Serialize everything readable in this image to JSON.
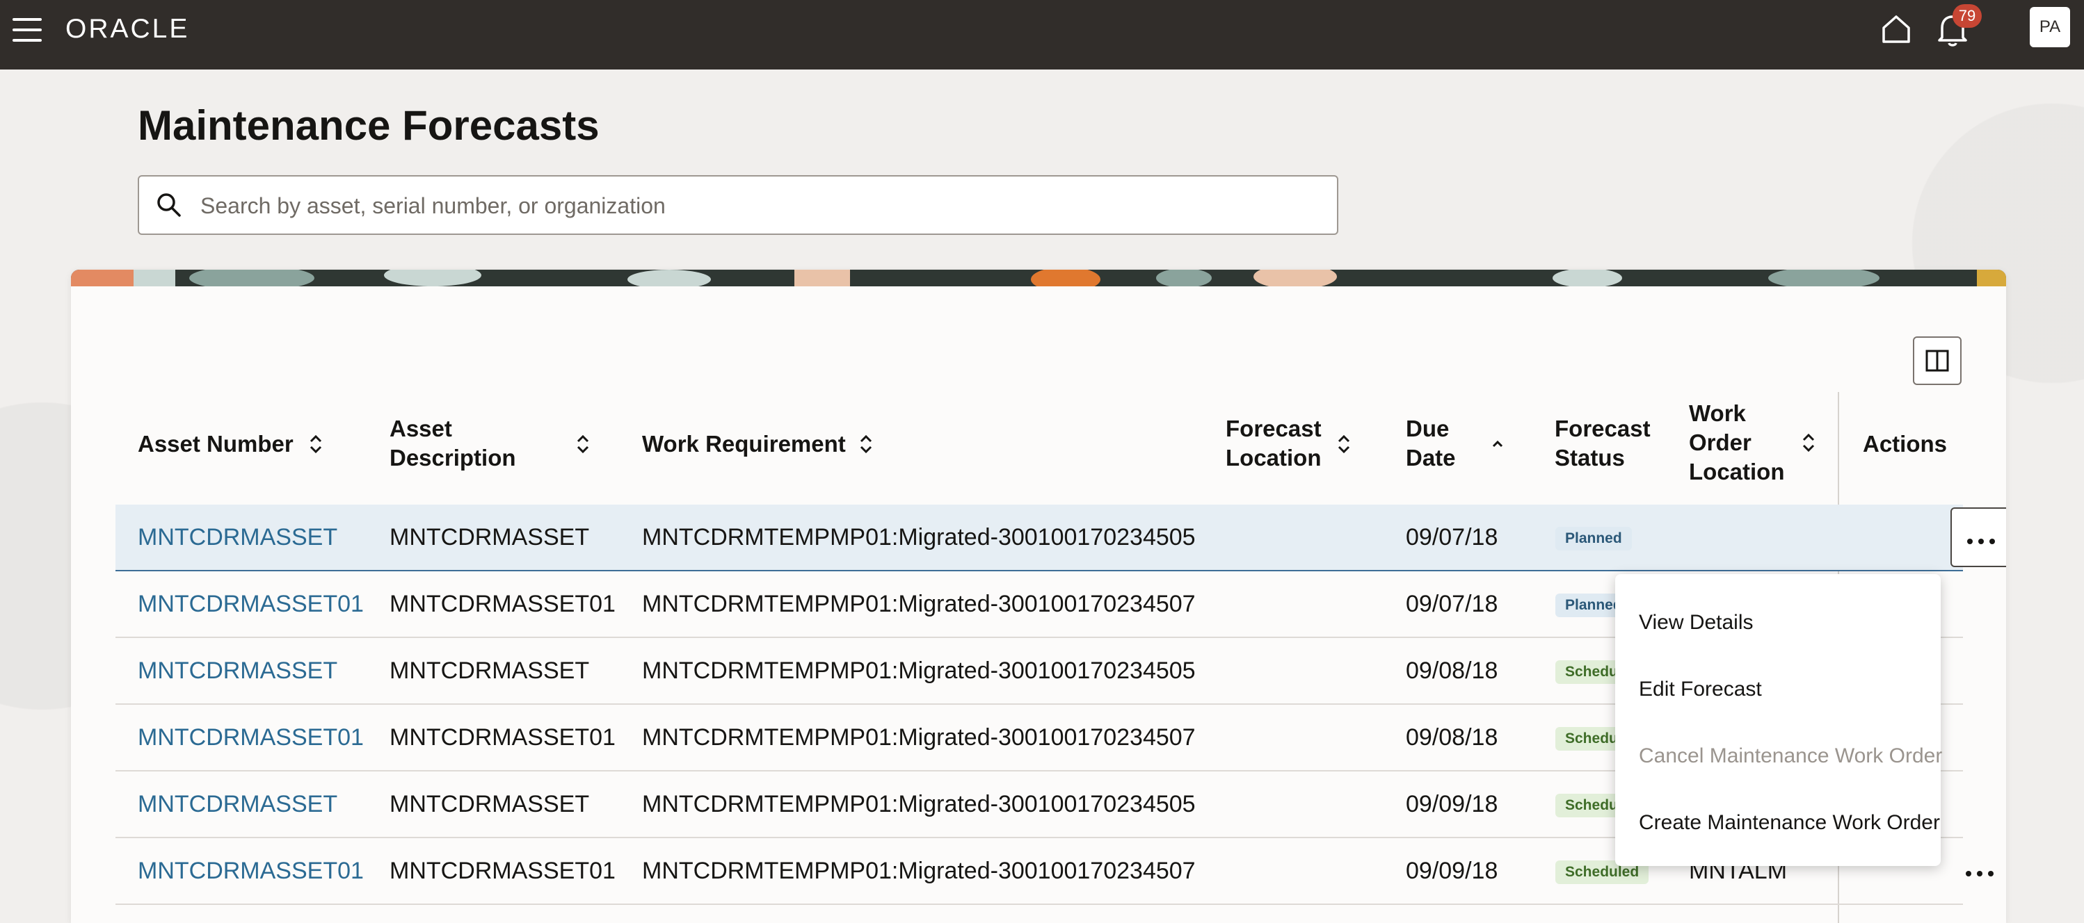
{
  "topbar": {
    "brand": "ORACLE",
    "notification_count": "79",
    "user_initials": "PA"
  },
  "page": {
    "title": "Maintenance Forecasts"
  },
  "search": {
    "placeholder": "Search by asset, serial number, or organization",
    "value": ""
  },
  "table": {
    "columns": [
      {
        "label": "Asset Number",
        "sort": "none"
      },
      {
        "label": "Asset Description",
        "sort": "none"
      },
      {
        "label": "Work Requirement",
        "sort": "none"
      },
      {
        "label": "Forecast Location",
        "sort": "none"
      },
      {
        "label": "Due Date",
        "sort": "ascending"
      },
      {
        "label": "Forecast Status",
        "sort": "none"
      },
      {
        "label": "Work Order Location",
        "sort": "none"
      },
      {
        "label": "Actions",
        "sort": "none"
      }
    ],
    "rows": [
      {
        "asset_number": "MNTCDRMASSET",
        "asset_description": "MNTCDRMASSET",
        "work_requirement": "MNTCDRMTEMPMP01:Migrated-300100170234505",
        "forecast_location": "",
        "due_date": "09/07/18",
        "status": "Planned",
        "work_order_location": ""
      },
      {
        "asset_number": "MNTCDRMASSET01",
        "asset_description": "MNTCDRMASSET01",
        "work_requirement": "MNTCDRMTEMPMP01:Migrated-300100170234507",
        "forecast_location": "",
        "due_date": "09/07/18",
        "status": "Planned",
        "work_order_location": ""
      },
      {
        "asset_number": "MNTCDRMASSET",
        "asset_description": "MNTCDRMASSET",
        "work_requirement": "MNTCDRMTEMPMP01:Migrated-300100170234505",
        "forecast_location": "",
        "due_date": "09/08/18",
        "status": "Scheduled",
        "work_order_location": ""
      },
      {
        "asset_number": "MNTCDRMASSET01",
        "asset_description": "MNTCDRMASSET01",
        "work_requirement": "MNTCDRMTEMPMP01:Migrated-300100170234507",
        "forecast_location": "",
        "due_date": "09/08/18",
        "status": "Scheduled",
        "work_order_location": ""
      },
      {
        "asset_number": "MNTCDRMASSET",
        "asset_description": "MNTCDRMASSET",
        "work_requirement": "MNTCDRMTEMPMP01:Migrated-300100170234505",
        "forecast_location": "",
        "due_date": "09/09/18",
        "status": "Scheduled",
        "work_order_location": ""
      },
      {
        "asset_number": "MNTCDRMASSET01",
        "asset_description": "MNTCDRMASSET01",
        "work_requirement": "MNTCDRMTEMPMP01:Migrated-300100170234507",
        "forecast_location": "",
        "due_date": "09/09/18",
        "status": "Scheduled",
        "work_order_location": "MNTALM"
      }
    ]
  },
  "actions_menu": {
    "items": [
      {
        "label": "View Details",
        "enabled": true
      },
      {
        "label": "Edit Forecast",
        "enabled": true
      },
      {
        "label": "Cancel Maintenance Work Order",
        "enabled": false
      },
      {
        "label": "Create Maintenance Work Order",
        "enabled": true
      }
    ]
  },
  "icons": {
    "menu": "hamburger-menu-icon",
    "home": "home-icon",
    "notifications": "bell-icon",
    "search": "search-icon",
    "sort": "sort-icon",
    "sort_ascending": "sort-ascending-icon",
    "columns": "column-panel-icon",
    "row_actions": "more-horizontal-icon"
  },
  "colors": {
    "topbar": "#312d2a",
    "link": "#2b6a93",
    "badge_alert": "#c74634",
    "selected_row": "#e6eef4",
    "planned_badge_bg": "#dfeaf2",
    "scheduled_badge_bg": "#e2efd9"
  }
}
